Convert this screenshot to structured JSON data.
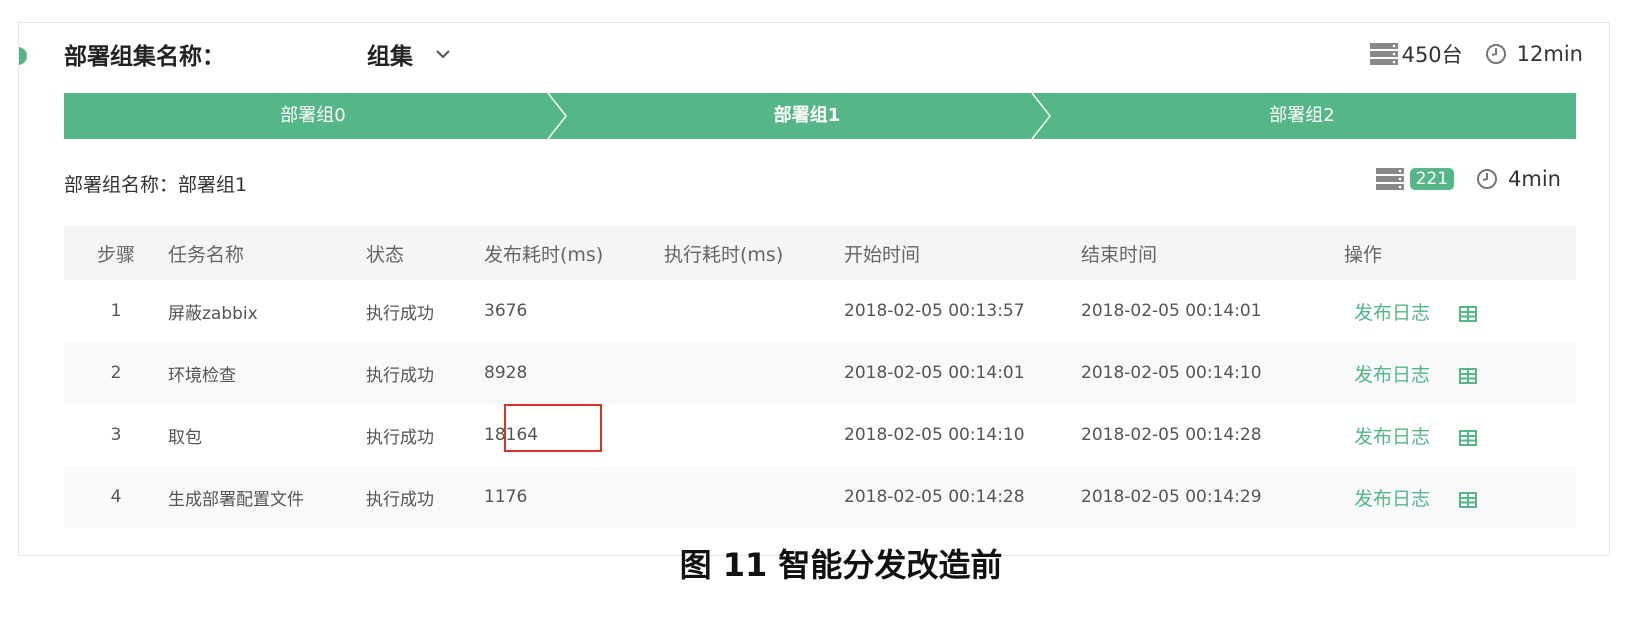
{
  "header": {
    "title_prefix": "部署组集名称：",
    "title_part1": "",
    "title_part2": "组集",
    "server_count": "450台",
    "duration": "12min"
  },
  "steps": [
    {
      "label": "部署组0",
      "active": false
    },
    {
      "label": "部署组1",
      "active": true
    },
    {
      "label": "部署组2",
      "active": false
    }
  ],
  "group": {
    "title": "部署组名称：部署组1",
    "server_badge": "221",
    "duration": "4min"
  },
  "table": {
    "headers": [
      "步骤",
      "任务名称",
      "状态",
      "发布耗时(ms)",
      "执行耗时(ms)",
      "开始时间",
      "结束时间",
      "操作"
    ],
    "rows": [
      {
        "step": "1",
        "name": "屏蔽zabbix",
        "status": "执行成功",
        "publish_ms": "3676",
        "exec_ms": "",
        "start": "2018-02-05 00:13:57",
        "end": "2018-02-05 00:14:01",
        "action": "发布日志"
      },
      {
        "step": "2",
        "name": "环境检查",
        "status": "执行成功",
        "publish_ms": "8928",
        "exec_ms": "",
        "start": "2018-02-05 00:14:01",
        "end": "2018-02-05 00:14:10",
        "action": "发布日志"
      },
      {
        "step": "3",
        "name": "取包",
        "status": "执行成功",
        "publish_ms": "18164",
        "exec_ms": "",
        "start": "2018-02-05 00:14:10",
        "end": "2018-02-05 00:14:28",
        "action": "发布日志"
      },
      {
        "step": "4",
        "name": "生成部署配置文件",
        "status": "执行成功",
        "publish_ms": "1176",
        "exec_ms": "",
        "start": "2018-02-05 00:14:28",
        "end": "2018-02-05 00:14:29",
        "action": "发布日志"
      }
    ]
  },
  "caption": "图 11  智能分发改造前",
  "colors": {
    "accent": "#55b788",
    "highlight": "#d9322b"
  },
  "icons": {
    "server": "server-stack-icon",
    "clock": "clock-icon",
    "chevron": "chevron-down-icon",
    "table": "table-grid-icon"
  }
}
